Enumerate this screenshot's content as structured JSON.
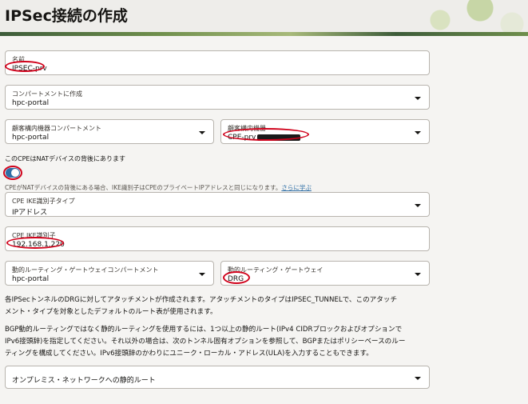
{
  "page": {
    "title": "IPSec接続の作成"
  },
  "fields": {
    "name": {
      "label": "名前",
      "value": "IPSEC-prv"
    },
    "compartment": {
      "label": "コンパートメントに作成",
      "value": "hpc-portal"
    },
    "cpe_compartment": {
      "label": "顧客構内機器コンパートメント",
      "value": "hpc-portal"
    },
    "cpe": {
      "label": "顧客構内機器",
      "value": "CPE-prv"
    },
    "cpe_ike_type": {
      "label": "CPE IKE識別子タイプ",
      "value": "IPアドレス"
    },
    "cpe_ike_id": {
      "label": "CPE IKE識別子",
      "value": "192.168.1.220"
    },
    "drg_compartment": {
      "label": "動的ルーティング・ゲートウェイコンパートメント",
      "value": "hpc-portal"
    },
    "drg": {
      "label": "動的ルーティング・ゲートウェイ",
      "value": "DRG"
    }
  },
  "nat": {
    "label": "このCPEはNATデバイスの背後にあります",
    "helper": "CPEがNATデバイスの背後にある場合、IKE識別子はCPEのプライベートIPアドレスと同じになります。",
    "learn_more": "さらに学ぶ",
    "enabled": true
  },
  "info": {
    "p1_line1": "各IPSecトンネルのDRGに対してアタッチメントが作成されます。アタッチメントのタイプはIPSEC_TUNNELで、このアタッチ",
    "p1_line2": "メント・タイプを対象としたデフォルトのルート表が使用されます。",
    "p2_line1": "BGP動的ルーティングではなく静的ルーティングを使用するには、1つ以上の静的ルート(IPv4 CIDRブロックおよびオプションで",
    "p2_line2": "IPv6接頭辞)を指定してください。それ以外の場合は、次のトンネル固有オプションを参照して、BGPまたはポリシーベースのルー",
    "p2_line3": "ティングを構成してください。IPv6接頭辞のかわりにユニーク・ローカル・アドレス(ULA)を入力することもできます。"
  },
  "static_routes": {
    "label": "オンプレミス・ネットワークへの静的ルート"
  },
  "colors": {
    "accent": "#2f6fa7",
    "annotation": "#d0021b"
  }
}
